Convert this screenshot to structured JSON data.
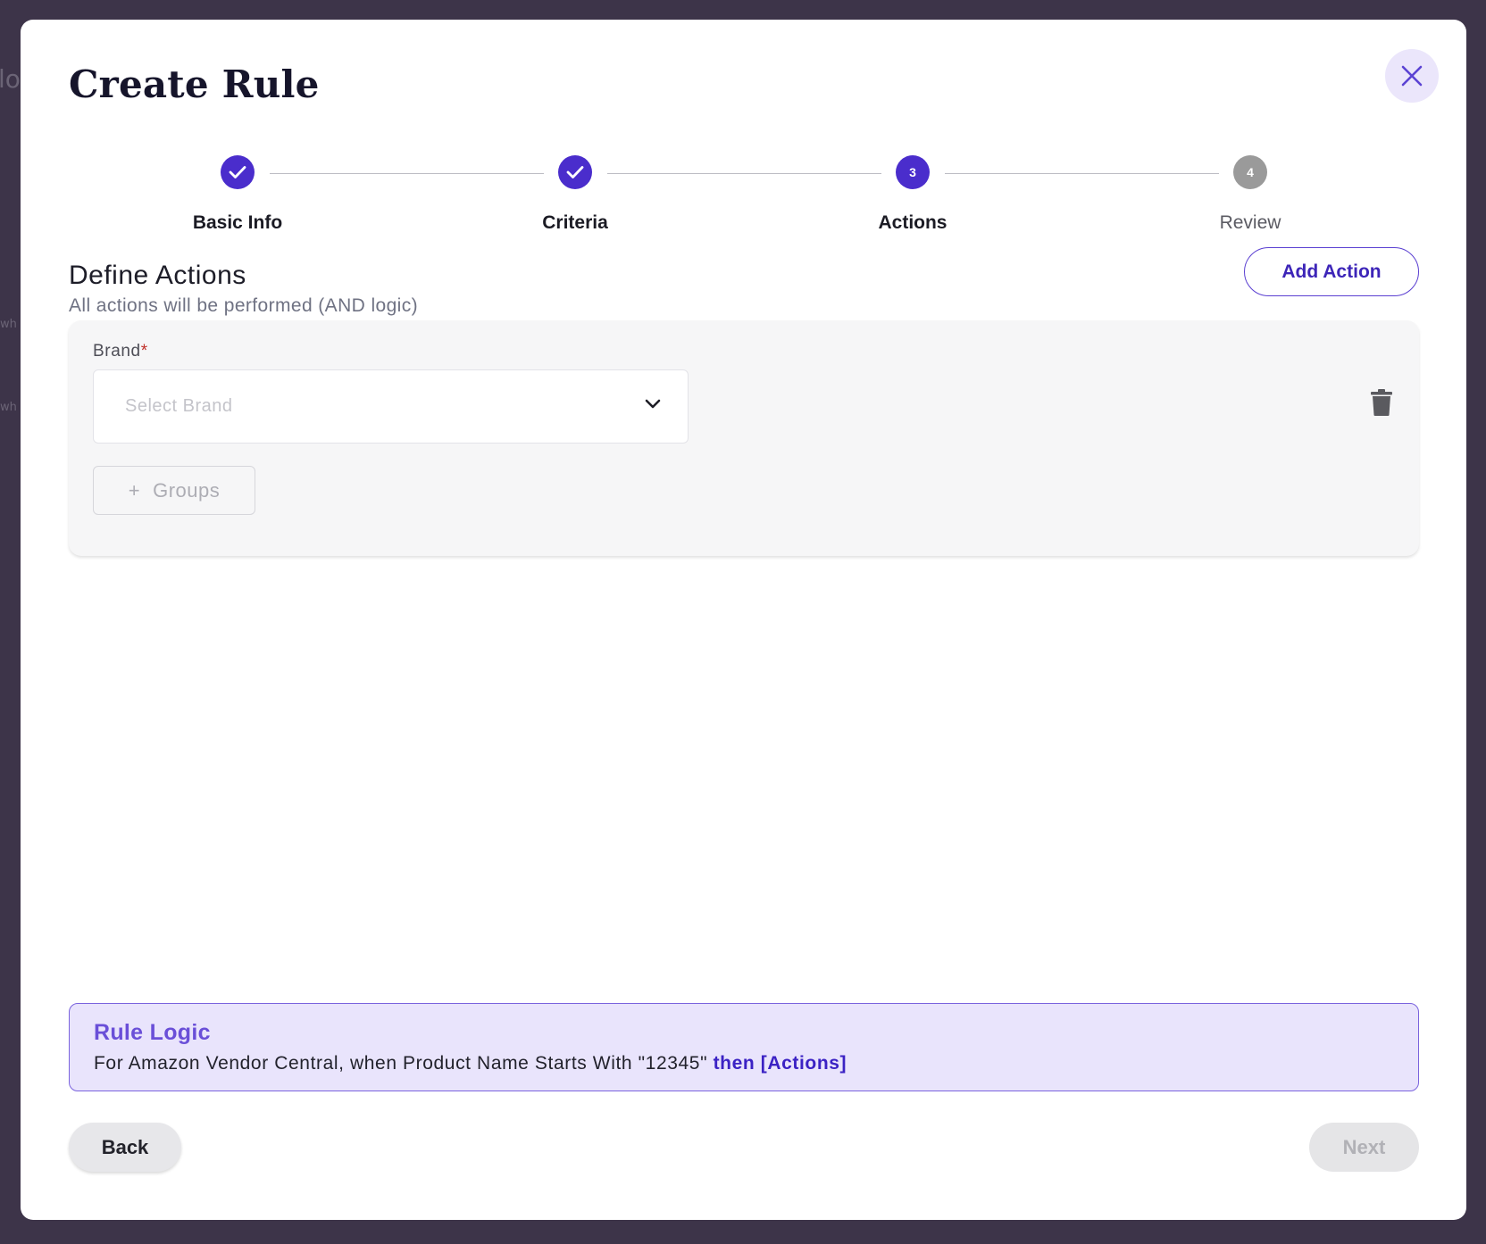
{
  "backdrop": {
    "fragment_1": "lo",
    "fragment_2": "wh",
    "fragment_3": "wh"
  },
  "modal": {
    "title": "Create Rule",
    "close_icon": "close-icon"
  },
  "stepper": {
    "steps": [
      {
        "label": "Basic Info",
        "state": "completed",
        "number": ""
      },
      {
        "label": "Criteria",
        "state": "completed",
        "number": ""
      },
      {
        "label": "Actions",
        "state": "active",
        "number": "3"
      },
      {
        "label": "Review",
        "state": "pending",
        "number": "4"
      }
    ]
  },
  "section": {
    "title": "Define Actions",
    "subtitle": "All actions will be performed (AND logic)",
    "add_action_label": "Add Action"
  },
  "action_card": {
    "brand_label": "Brand",
    "required_mark": "*",
    "brand_placeholder": "Select Brand",
    "groups_label": "Groups",
    "groups_plus": "+"
  },
  "rule_logic": {
    "title": "Rule Logic",
    "text": "For Amazon Vendor Central, when Product Name Starts With \"12345\"",
    "highlight": "then [Actions]"
  },
  "footer": {
    "back_label": "Back",
    "next_label": "Next"
  },
  "colors": {
    "accent": "#4a2dcc",
    "backdrop": "#3d3449",
    "logic_bg": "#e9e4fc",
    "pending": "#9a9a9a"
  }
}
